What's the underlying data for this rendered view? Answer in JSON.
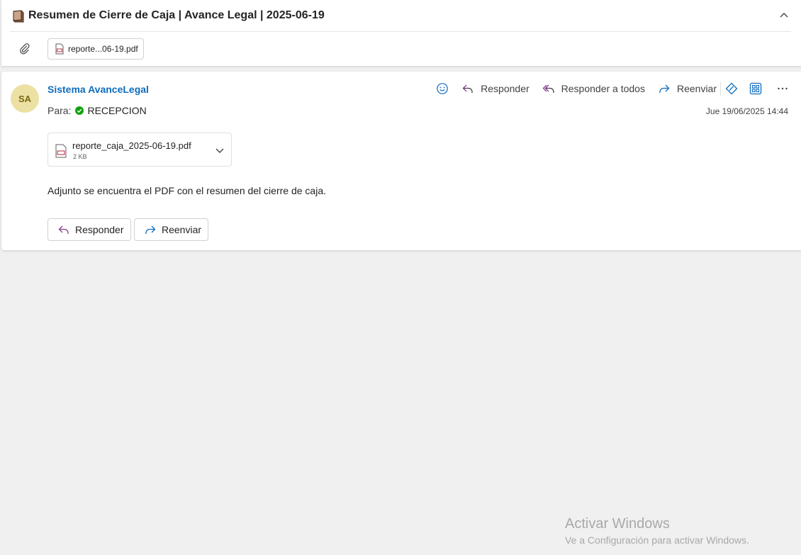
{
  "subject": {
    "title": "Resumen de Cierre de Caja | Avance Legal | 2025-06-19"
  },
  "attachment_bar": {
    "chip_label": "reporte...06-19.pdf"
  },
  "message": {
    "avatar_initials": "SA",
    "sender": "Sistema AvanceLegal",
    "to_label": "Para:",
    "recipient": "RECEPCION",
    "date": "Jue 19/06/2025 14:44",
    "actions": {
      "reply": "Responder",
      "reply_all": "Responder a todos",
      "forward": "Reenviar"
    },
    "attachment": {
      "name": "reporte_caja_2025-06-19.pdf",
      "size": "2 KB"
    },
    "body": "Adjunto se encuentra el PDF con el resumen del cierre de caja.",
    "buttons": {
      "reply": "Responder",
      "forward": "Reenviar"
    }
  },
  "watermark": {
    "line1": "Activar Windows",
    "line2": "Ve a Configuración para activar Windows."
  },
  "colors": {
    "accent": "#0f6cbd",
    "avatar_bg": "#ece1a3",
    "reply_icon": "#8a3c8e",
    "presence": "#13a10e",
    "pdf_red": "#c4314b"
  }
}
